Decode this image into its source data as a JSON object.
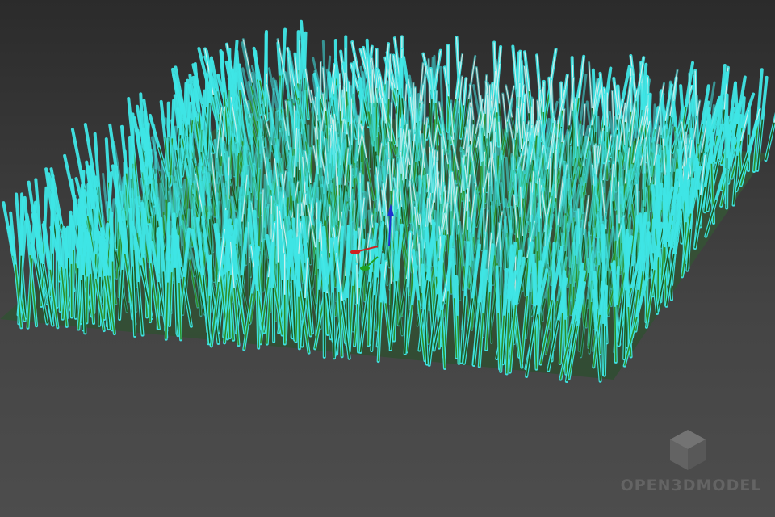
{
  "viewport": {
    "background_top": "#2b2b2b",
    "background_bottom": "#4d4d4d"
  },
  "scene": {
    "object": "grass-patch",
    "colors": {
      "selection_outline": "#3fe6e6",
      "blade_green": "#2f8f2a",
      "blade_dark": "#1e5a1e",
      "blade_white": "#e8f2ee",
      "gizmo_x": "#d02020",
      "gizmo_y": "#20a020",
      "gizmo_z": "#2030d0"
    }
  },
  "gizmo": {
    "axes": [
      "x-axis",
      "y-axis",
      "z-axis"
    ]
  },
  "watermark": {
    "icon": "cube-icon",
    "text": "OPEN3DMODEL"
  }
}
